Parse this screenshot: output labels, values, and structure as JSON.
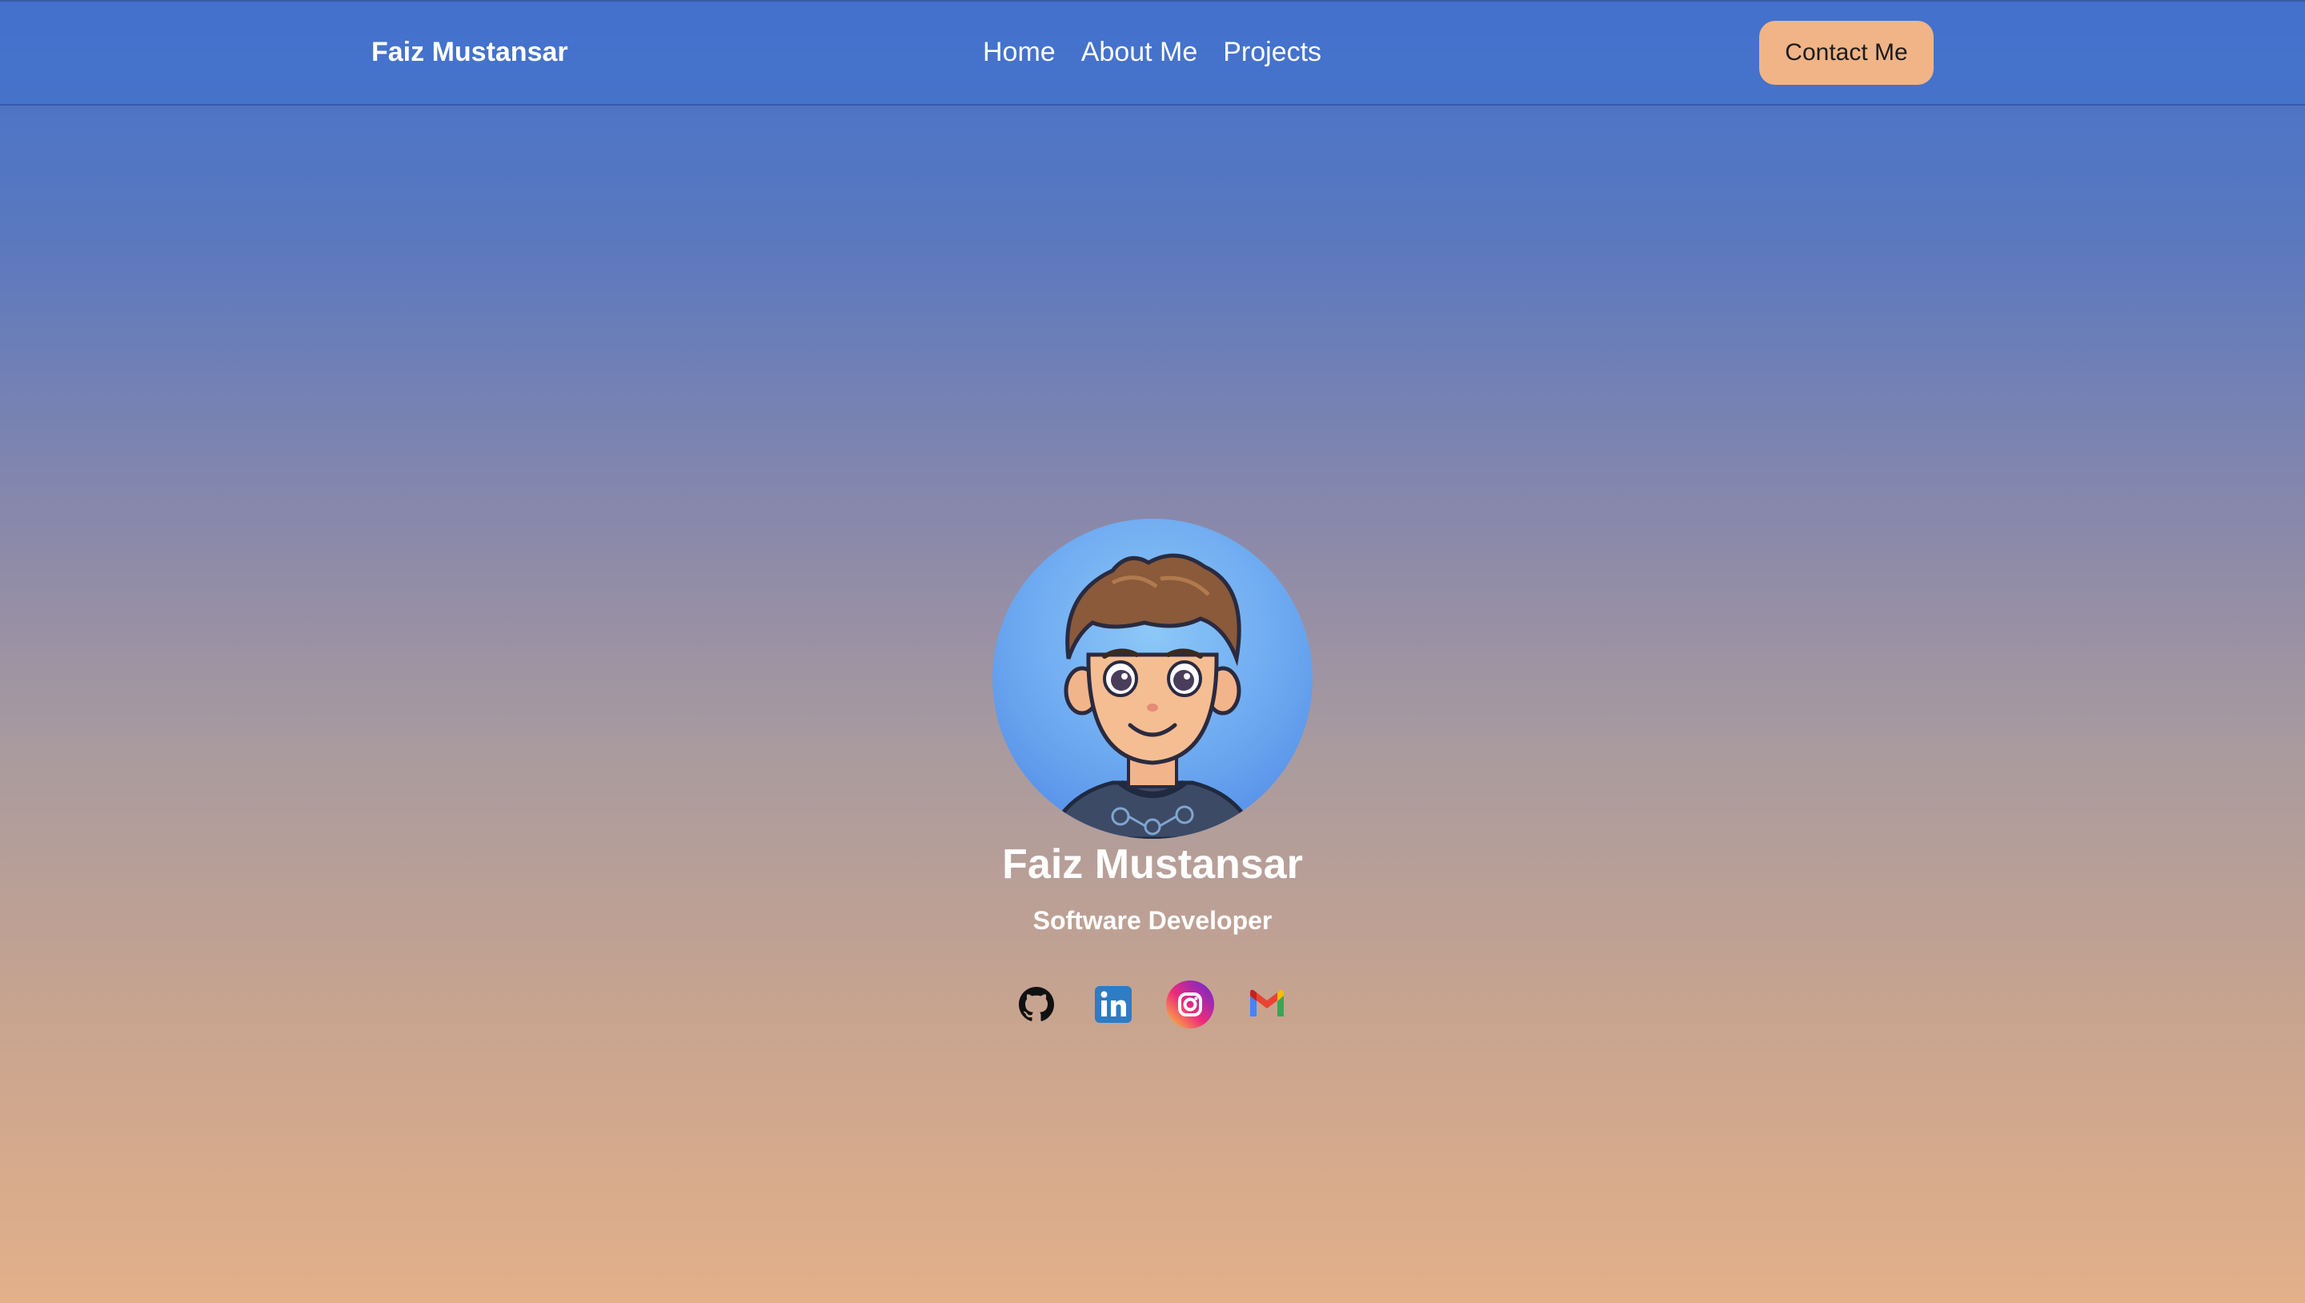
{
  "nav": {
    "brand": "Faiz Mustansar",
    "links": [
      "Home",
      "About Me",
      "Projects"
    ],
    "contact_button": "Contact Me"
  },
  "hero": {
    "avatar_alt": "avatar",
    "name": "Faiz Mustansar",
    "role": "Software Developer"
  },
  "socials": [
    {
      "icon": "github-icon"
    },
    {
      "icon": "linkedin-icon"
    },
    {
      "icon": "instagram-icon"
    },
    {
      "icon": "gmail-icon"
    }
  ],
  "colors": {
    "accent_button": "#f0b486",
    "nav_bg": "#4471cc",
    "gradient_bottom": "#e3b08a"
  }
}
